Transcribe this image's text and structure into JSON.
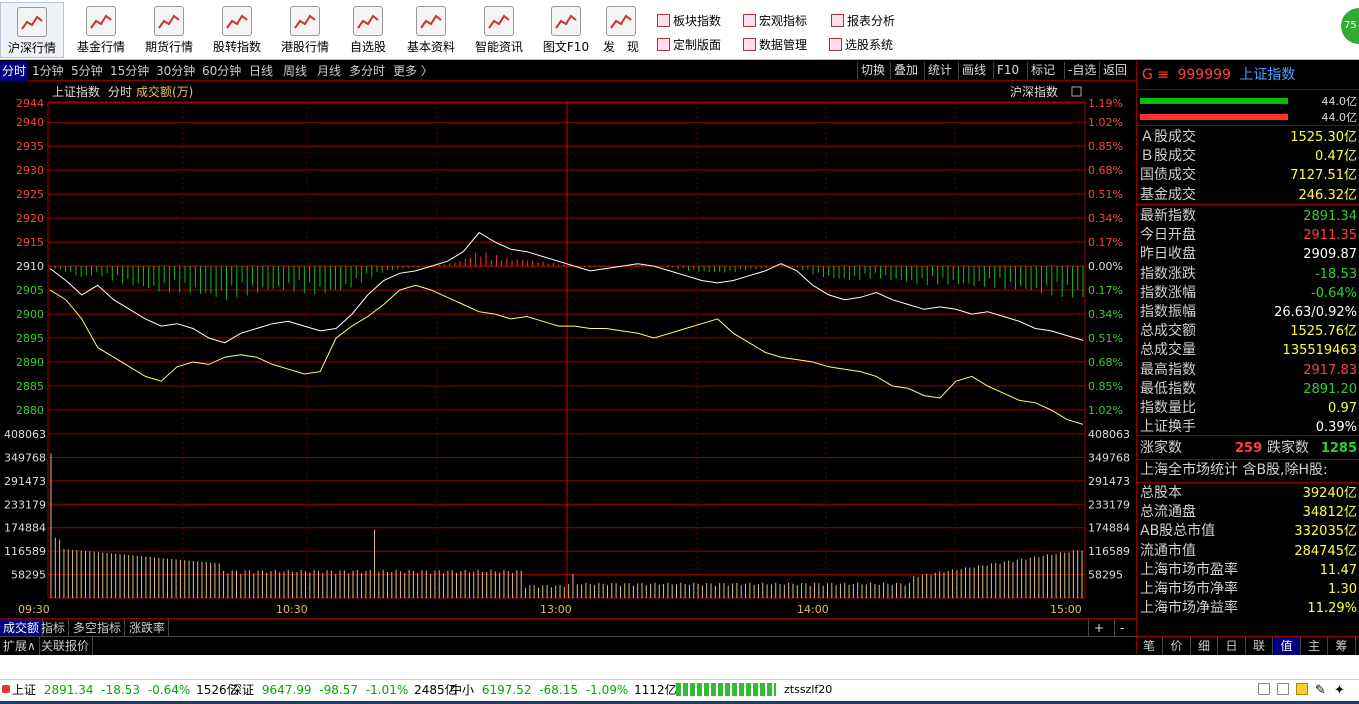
{
  "toolbar": {
    "buttons": [
      {
        "label": "沪深行情",
        "icon": "line-chart-icon"
      },
      {
        "label": "基金行情",
        "icon": "bar-chart-icon"
      },
      {
        "label": "期货行情",
        "icon": "futures-chart-icon"
      },
      {
        "label": "股转指数",
        "icon": "grid-chart-icon"
      },
      {
        "label": "港股行情",
        "icon": "hk-chart-icon"
      },
      {
        "label": "自选股",
        "icon": "magnifier-icon"
      },
      {
        "label": "基本资料",
        "icon": "key-icon"
      },
      {
        "label": "智能资讯",
        "icon": "key-icon"
      },
      {
        "label": "图文F10",
        "icon": "document-icon"
      },
      {
        "label": "发　现",
        "icon": "discover-chart-icon"
      }
    ],
    "small": [
      {
        "label": "板块指数",
        "icon": "sector-icon"
      },
      {
        "label": "宏观指标",
        "icon": "macro-icon"
      },
      {
        "label": "报表分析",
        "icon": "report-icon"
      },
      {
        "label": "定制版面",
        "icon": "layout-icon"
      },
      {
        "label": "数据管理",
        "icon": "data-icon"
      },
      {
        "label": "选股系统",
        "icon": "screener-icon"
      }
    ],
    "logo_text": "75"
  },
  "periods": [
    "分时",
    "1分钟",
    "5分钟",
    "15分钟",
    "30分钟",
    "60分钟",
    "日线",
    "周线",
    "月线",
    "多分时",
    "更多 〉"
  ],
  "chart_tools": [
    "切换",
    "叠加",
    "统计",
    "画线",
    "F10",
    "标记",
    "-自选",
    "返回"
  ],
  "chart_header": {
    "name": "上证指数",
    "mode": "分时",
    "volume_label": "成交额(万)",
    "compare": "沪深指数"
  },
  "chart_data": {
    "type": "line",
    "title": "上证指数 分时",
    "prev_close": 2909.87,
    "price_axis": {
      "ticks": [
        2944,
        2940,
        2935,
        2930,
        2925,
        2920,
        2915,
        2910,
        2905,
        2900,
        2895,
        2890,
        2885,
        2880
      ],
      "pct_ticks": [
        "1.19%",
        "1.02%",
        "0.85%",
        "0.68%",
        "0.51%",
        "0.34%",
        "0.17%",
        "0.00%",
        "0.17%",
        "0.34%",
        "0.51%",
        "0.68%",
        "0.85%",
        "1.02%"
      ]
    },
    "volume_axis": {
      "ticks": [
        408063,
        349768,
        291473,
        233179,
        174884,
        116589,
        58295
      ]
    },
    "x_labels": [
      "09:30",
      "10:30",
      "13:00",
      "14:00",
      "15:00"
    ],
    "series": [
      {
        "name": "上证指数",
        "color": "#ffffff",
        "values": [
          2909.5,
          2907,
          2904,
          2906,
          2903,
          2901,
          2899,
          2897.5,
          2898,
          2897,
          2895,
          2894,
          2896,
          2897,
          2898,
          2898.5,
          2897.5,
          2896.5,
          2897,
          2900,
          2904,
          2907,
          2908.5,
          2909,
          2910,
          2911,
          2913,
          2917,
          2915,
          2913.5,
          2913,
          2912,
          2911,
          2910,
          2909,
          2909.5,
          2910,
          2910.5,
          2910,
          2909,
          2908,
          2907,
          2906.5,
          2907,
          2908,
          2909,
          2910.5,
          2909,
          2906,
          2904,
          2903,
          2903.5,
          2904.5,
          2903,
          2902,
          2901,
          2901.5,
          2901,
          2900,
          2900.5,
          2899.5,
          2898.5,
          2897,
          2896.5,
          2895.5,
          2894.5
        ]
      },
      {
        "name": "",
        "color": "#ffff60",
        "values": [
          2905,
          2903,
          2899,
          2893,
          2891,
          2889,
          2887,
          2886,
          2889,
          2890,
          2889.5,
          2891,
          2891.5,
          2891,
          2889.5,
          2888.5,
          2887.5,
          2888,
          2895,
          2897.5,
          2899.5,
          2902,
          2905,
          2906,
          2905,
          2903.5,
          2902,
          2900.5,
          2900,
          2899,
          2899.5,
          2898.5,
          2897.5,
          2897.5,
          2897,
          2897,
          2896.5,
          2896,
          2895,
          2896,
          2897,
          2898,
          2899,
          2896,
          2894,
          2892,
          2891,
          2890.5,
          2890,
          2889,
          2888.5,
          2888,
          2887,
          2885,
          2884.5,
          2883,
          2882.5,
          2886,
          2887,
          2885,
          2883.5,
          2882,
          2881.5,
          2880,
          2878,
          2877
        ]
      }
    ]
  },
  "right_panel": {
    "title_marker": "G ≡",
    "code": "999999",
    "name": "上证指数",
    "bars": [
      {
        "value": "44.0亿",
        "color": "#00c000"
      },
      {
        "value": "44.0亿",
        "color": "#ff3030"
      }
    ],
    "rows1": [
      {
        "label": "Ａ股成交",
        "value": "1525.30亿"
      },
      {
        "label": "Ｂ股成交",
        "value": "0.47亿"
      },
      {
        "label": "国债成交",
        "value": "7127.51亿"
      },
      {
        "label": "基金成交",
        "value": "246.32亿"
      }
    ],
    "rows2": [
      {
        "label": "最新指数",
        "value": "2891.34",
        "color": "#30d030"
      },
      {
        "label": "今日开盘",
        "value": "2911.35",
        "color": "#ff4040"
      },
      {
        "label": "昨日收盘",
        "value": "2909.87",
        "color": "#ffffff"
      },
      {
        "label": "指数涨跌",
        "value": "-18.53",
        "color": "#30d030"
      },
      {
        "label": "指数涨幅",
        "value": "-0.64%",
        "color": "#30d030"
      },
      {
        "label": "指数振幅",
        "value": "26.63/0.92%",
        "color": "#ffffff"
      },
      {
        "label": "总成交额",
        "value": "1525.76亿",
        "color": "#ffff40"
      },
      {
        "label": "总成交量",
        "value": "135519463",
        "color": "#ffff40"
      },
      {
        "label": "最高指数",
        "value": "2917.83",
        "color": "#ff4040"
      },
      {
        "label": "最低指数",
        "value": "2891.20",
        "color": "#30d030"
      },
      {
        "label": "指数量比",
        "value": "0.97",
        "color": "#ffff40"
      },
      {
        "label": "上证换手",
        "value": "0.39%",
        "color": "#ffffff"
      }
    ],
    "updown": {
      "up_label": "涨家数",
      "up": "259",
      "down_label": "跌家数",
      "down": "1285"
    },
    "market_title": "上海全市场统计 含B股,除H股:",
    "rows3": [
      {
        "label": "总股本",
        "value": "39240亿"
      },
      {
        "label": "总流通盘",
        "value": "34812亿"
      },
      {
        "label": "AB股总市值",
        "value": "332035亿"
      },
      {
        "label": "流通市值",
        "value": "284745亿"
      },
      {
        "label": "上海市场市盈率",
        "value": "11.47"
      },
      {
        "label": "上海市场市净率",
        "value": "1.30"
      },
      {
        "label": "上海市场净益率",
        "value": "11.29%"
      }
    ],
    "tabs": [
      "笔",
      "价",
      "细",
      "日",
      "联",
      "值",
      "主",
      "筹"
    ]
  },
  "bottom_tabs": [
    "成交额",
    "指标",
    "多空指标",
    "涨跌率"
  ],
  "zoom": [
    "+",
    "-"
  ],
  "ext_tabs": [
    "扩展∧",
    "关联报价"
  ],
  "status": {
    "sh": {
      "name": "上证",
      "price": "2891.34",
      "chg": "-18.53",
      "pct": "-0.64%",
      "amt": "1526亿"
    },
    "sz": {
      "name": "深证",
      "price": "9647.99",
      "chg": "-98.57",
      "pct": "-1.01%",
      "amt": "2485亿"
    },
    "zx": {
      "name": "中小",
      "price": "6197.52",
      "chg": "-68.15",
      "pct": "-1.09%",
      "amt": "1112亿"
    },
    "server": "ztsszlf20"
  }
}
